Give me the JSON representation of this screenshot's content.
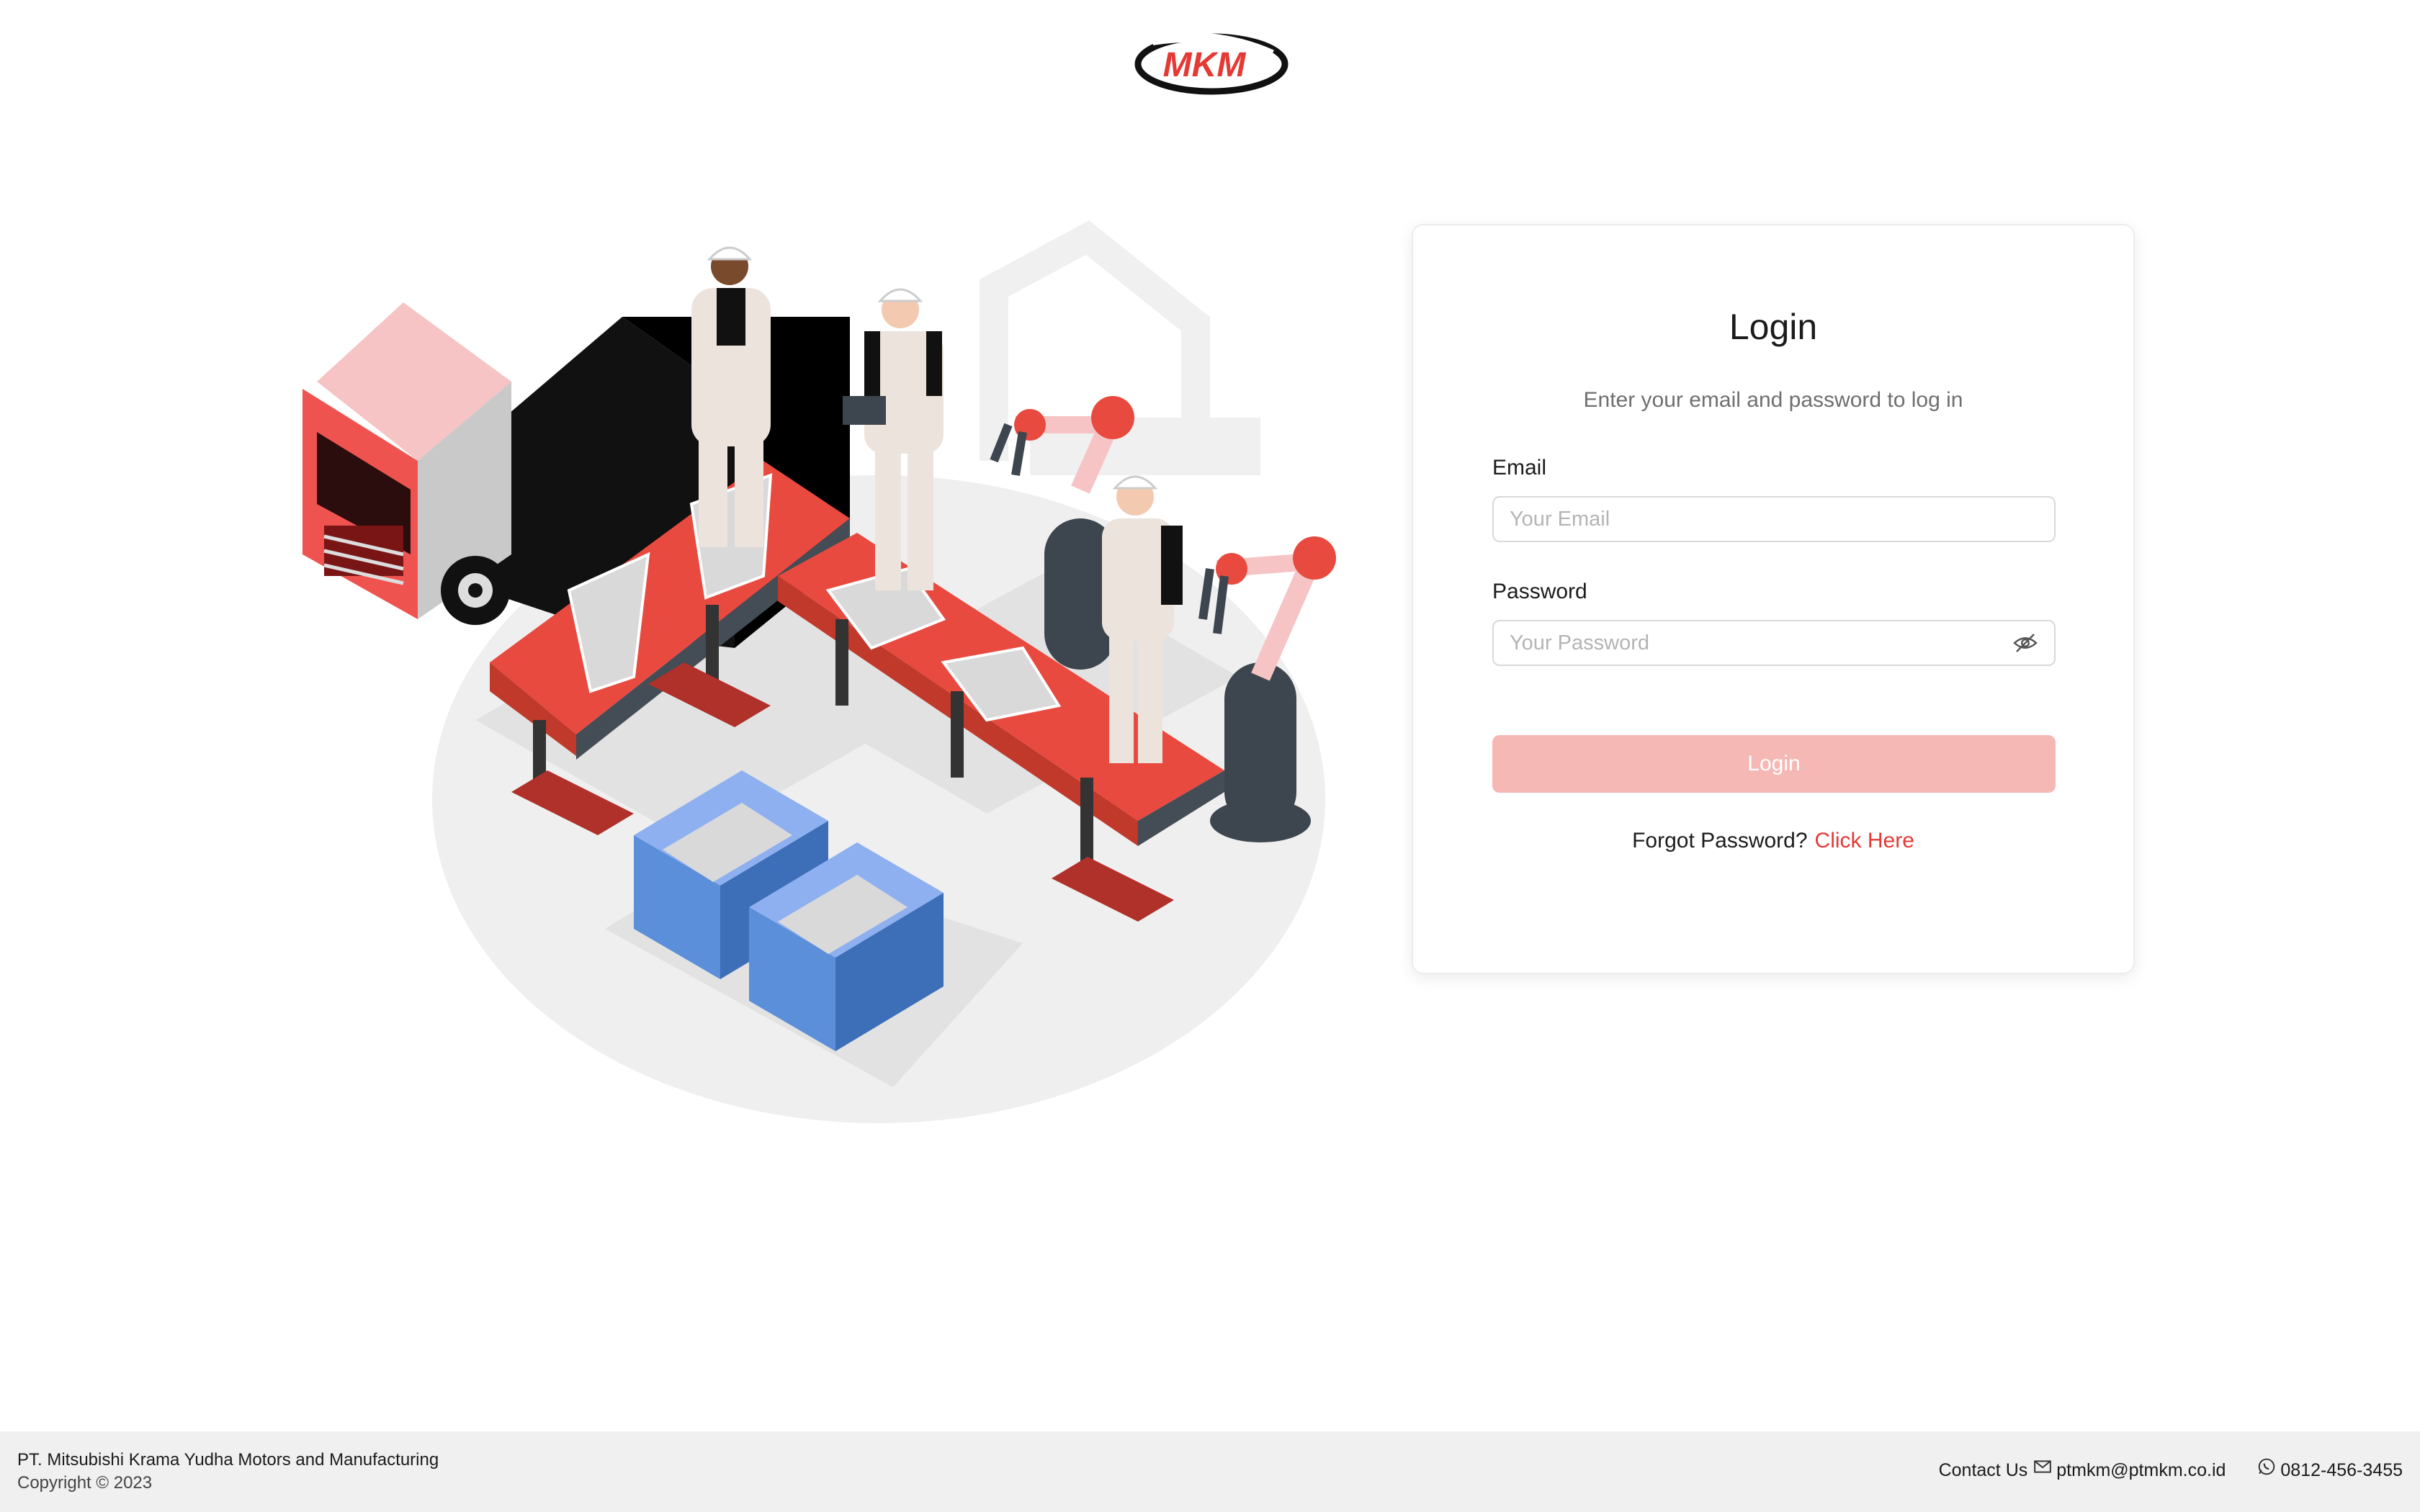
{
  "brand": {
    "logo_text": "MKM",
    "accent": "#e53935"
  },
  "login": {
    "title": "Login",
    "subtitle": "Enter your email and password to log in",
    "email_label": "Email",
    "email_placeholder": "Your Email",
    "password_label": "Password",
    "password_placeholder": "Your Password",
    "button_label": "Login",
    "button_color": "#f5b8b5",
    "forgot_text": "Forgot Password?",
    "forgot_link": "Click Here"
  },
  "footer": {
    "company": "PT. Mitsubishi Krama Yudha Motors and Manufacturing",
    "copyright": "Copyright © 2023",
    "contact_label": "Contact Us",
    "email": "ptmkm@ptmkm.co.id",
    "phone": "0812-456-3455",
    "email_icon": "mail-icon",
    "phone_icon": "whatsapp-icon"
  }
}
